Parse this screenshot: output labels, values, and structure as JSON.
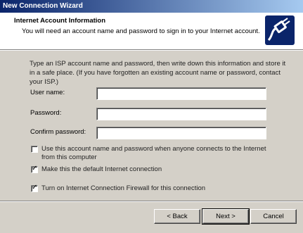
{
  "window": {
    "title": "New Connection Wizard"
  },
  "header": {
    "title": "Internet Account Information",
    "subtitle": "You will need an account name and password to sign in to your Internet account.",
    "icon": "connection-plug-icon"
  },
  "intro": "Type an ISP account name and password, then write down this information and store it in a safe place. (If you have forgotten an existing account name or password, contact your ISP.)",
  "fields": {
    "user_name": {
      "label": "User name:",
      "value": ""
    },
    "password": {
      "label": "Password:",
      "value": ""
    },
    "confirm_password": {
      "label": "Confirm password:",
      "value": ""
    }
  },
  "options": [
    {
      "label": "Use this account name and password when anyone connects to the Internet from this computer",
      "checked": false
    },
    {
      "label": "Make this the default Internet connection",
      "checked": true
    },
    {
      "label": "Turn on Internet Connection Firewall for this connection",
      "checked": true
    }
  ],
  "buttons": {
    "back": "< Back",
    "next": "Next >",
    "cancel": "Cancel"
  },
  "colors": {
    "title_bar_start": "#0a246a",
    "title_bar_end": "#a6caf0",
    "dialog_face": "#d4d0c8",
    "header_bg": "#ffffff"
  }
}
